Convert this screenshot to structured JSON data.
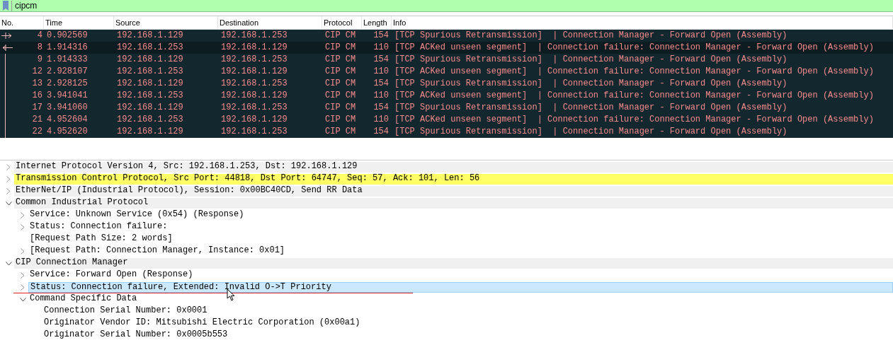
{
  "filter": {
    "value": "cipcm"
  },
  "table": {
    "columns": [
      "No.",
      "Time",
      "Source",
      "Destination",
      "Protocol",
      "Length",
      "Info"
    ],
    "rows": [
      {
        "cells": [
          "4",
          "0.902569",
          "192.168.1.129",
          "192.168.1.253",
          "CIP CM",
          "154",
          "[TCP Spurious Retransmission]  | Connection Manager - Forward Open (Assembly)"
        ],
        "kind": "request",
        "selected": false
      },
      {
        "cells": [
          "8",
          "1.914316",
          "192.168.1.253",
          "192.168.1.129",
          "CIP CM",
          "110",
          "[TCP ACKed unseen segment]  | Connection failure: Connection Manager - Forward Open (Assembly)"
        ],
        "kind": "response",
        "selected": true
      },
      {
        "cells": [
          "9",
          "1.914333",
          "192.168.1.129",
          "192.168.1.253",
          "CIP CM",
          "154",
          "[TCP Spurious Retransmission]  | Connection Manager - Forward Open (Assembly)"
        ],
        "kind": "plain",
        "selected": false
      },
      {
        "cells": [
          "12",
          "2.928107",
          "192.168.1.253",
          "192.168.1.129",
          "CIP CM",
          "110",
          "[TCP ACKed unseen segment]  | Connection failure: Connection Manager - Forward Open (Assembly)"
        ],
        "kind": "plain",
        "selected": false
      },
      {
        "cells": [
          "13",
          "2.928125",
          "192.168.1.129",
          "192.168.1.253",
          "CIP CM",
          "154",
          "[TCP Spurious Retransmission]  | Connection Manager - Forward Open (Assembly)"
        ],
        "kind": "plain",
        "selected": false
      },
      {
        "cells": [
          "16",
          "3.941041",
          "192.168.1.253",
          "192.168.1.129",
          "CIP CM",
          "110",
          "[TCP ACKed unseen segment]  | Connection failure: Connection Manager - Forward Open (Assembly)"
        ],
        "kind": "plain",
        "selected": false
      },
      {
        "cells": [
          "17",
          "3.941060",
          "192.168.1.129",
          "192.168.1.253",
          "CIP CM",
          "154",
          "[TCP Spurious Retransmission]  | Connection Manager - Forward Open (Assembly)"
        ],
        "kind": "plain",
        "selected": false
      },
      {
        "cells": [
          "21",
          "4.952604",
          "192.168.1.253",
          "192.168.1.129",
          "CIP CM",
          "110",
          "[TCP ACKed unseen segment]  | Connection failure: Connection Manager - Forward Open (Assembly)"
        ],
        "kind": "plain",
        "selected": false
      },
      {
        "cells": [
          "22",
          "4.952620",
          "192.168.1.129",
          "192.168.1.253",
          "CIP CM",
          "154",
          "[TCP Spurious Retransmission]  | Connection Manager - Forward Open (Assembly)"
        ],
        "kind": "plain",
        "selected": false
      }
    ]
  },
  "details": [
    {
      "label": "Internet Protocol Version 4, Src: 192.168.1.253, Dst: 192.168.1.129",
      "kind": "node",
      "expanded": false,
      "warning": false,
      "selected": false
    },
    {
      "label": "Transmission Control Protocol, Src Port: 44818, Dst Port: 64747, Seq: 57, Ack: 101, Len: 56",
      "kind": "node",
      "expanded": false,
      "warning": true,
      "selected": false
    },
    {
      "label": "EtherNet/IP (Industrial Protocol), Session: 0x00BC40CD, Send RR Data",
      "kind": "node",
      "expanded": false,
      "warning": false,
      "selected": false
    },
    {
      "label": "Common Industrial Protocol",
      "kind": "node",
      "expanded": true,
      "warning": false,
      "selected": false,
      "children": [
        {
          "label": "Service: Unknown Service (0x54) (Response)",
          "kind": "node",
          "expanded": false,
          "warning": false,
          "selected": false
        },
        {
          "label": "Status: Connection failure:",
          "kind": "node",
          "expanded": false,
          "warning": false,
          "selected": false
        },
        {
          "label": "[Request Path Size: 2 words]",
          "kind": "leaf",
          "warning": false,
          "selected": false
        },
        {
          "label": "[Request Path: Connection Manager, Instance: 0x01]",
          "kind": "node",
          "expanded": false,
          "warning": false,
          "selected": false
        }
      ]
    },
    {
      "label": "CIP Connection Manager",
      "kind": "node",
      "expanded": true,
      "warning": false,
      "selected": false,
      "children": [
        {
          "label": "Service: Forward Open (Response)",
          "kind": "node",
          "expanded": false,
          "warning": false,
          "selected": false
        },
        {
          "label": "Status: Connection failure, Extended: Invalid O->T Priority",
          "kind": "node",
          "expanded": false,
          "warning": false,
          "selected": true
        },
        {
          "label": "Command Specific Data",
          "kind": "node",
          "expanded": true,
          "warning": false,
          "selected": false,
          "children": [
            {
              "label": "Connection Serial Number: 0x0001",
              "kind": "leaf",
              "warning": false,
              "selected": false
            },
            {
              "label": "Originator Vendor ID: Mitsubishi Electric Corporation (0x00a1)",
              "kind": "leaf",
              "warning": false,
              "selected": false
            },
            {
              "label": "Originator Serial Number: 0x0005b553",
              "kind": "leaf",
              "warning": false,
              "selected": false
            }
          ]
        }
      ]
    }
  ]
}
